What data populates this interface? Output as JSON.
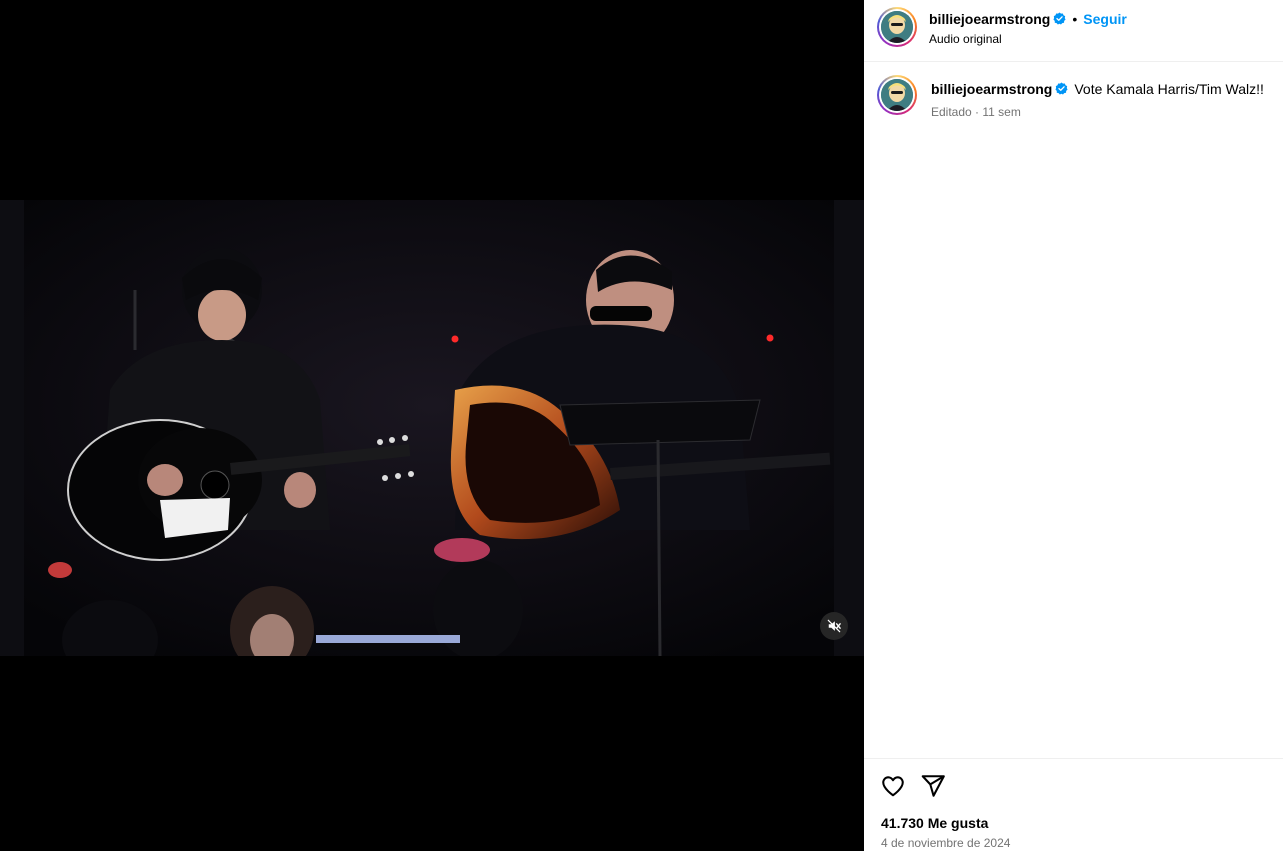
{
  "post": {
    "username": "billiejoearmstrong",
    "verified_icon": "verified-badge-icon",
    "separator": "•",
    "follow_label": "Seguir",
    "audio_label": "Audio original"
  },
  "caption": {
    "username": "billiejoearmstrong",
    "text": "Vote Kamala Harris/Tim Walz!!",
    "edited_label": "Editado",
    "meta_sep": "·",
    "time_ago": "11 sem"
  },
  "actions": {
    "like_icon": "heart-icon",
    "share_icon": "paper-plane-icon"
  },
  "stats": {
    "likes": "41.730 Me gusta",
    "date": "4 de noviembre de 2024"
  },
  "video": {
    "mute_icon": "speaker-muted-icon"
  },
  "colors": {
    "accent": "#0095f6",
    "verified": "#0095f6",
    "muted_text": "#737373"
  }
}
